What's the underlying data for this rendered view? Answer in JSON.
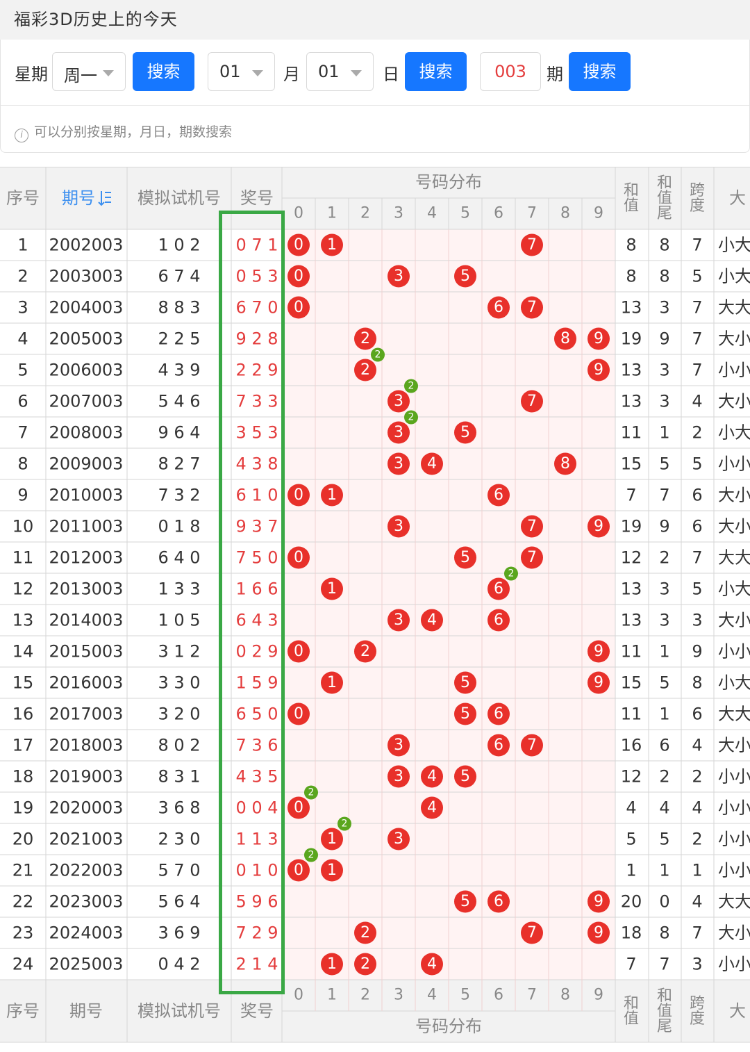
{
  "page_title": "福彩3D历史上的今天",
  "search": {
    "weekday_label": "星期",
    "weekday_value": "周一",
    "search_button": "搜索",
    "month_value": "01",
    "month_label": "月",
    "day_value": "01",
    "day_label": "日",
    "period_value": "003",
    "period_label": "期",
    "hint": "可以分别按星期，月日，期数搜索"
  },
  "table": {
    "headers": {
      "seq": "序号",
      "period": "期号",
      "sim": "模拟试机号",
      "prize": "奖号",
      "dist": "号码分布",
      "sum": "和值",
      "sum_tail": "和值尾",
      "span": "跨度",
      "big": "大"
    },
    "digits": [
      "0",
      "1",
      "2",
      "3",
      "4",
      "5",
      "6",
      "7",
      "8",
      "9"
    ],
    "rows": [
      {
        "seq": "1",
        "period": "2002003",
        "sim": "1 0 2",
        "prize": "0 7 1",
        "sum": "8",
        "tail": "8",
        "span": "7",
        "bs": "小大"
      },
      {
        "seq": "2",
        "period": "2003003",
        "sim": "6 7 4",
        "prize": "0 5 3",
        "sum": "8",
        "tail": "8",
        "span": "5",
        "bs": "小大"
      },
      {
        "seq": "3",
        "period": "2004003",
        "sim": "8 8 3",
        "prize": "6 7 0",
        "sum": "13",
        "tail": "3",
        "span": "7",
        "bs": "大大"
      },
      {
        "seq": "4",
        "period": "2005003",
        "sim": "2 2 5",
        "prize": "9 2 8",
        "sum": "19",
        "tail": "9",
        "span": "7",
        "bs": "大小"
      },
      {
        "seq": "5",
        "period": "2006003",
        "sim": "4 3 9",
        "prize": "2 2 9",
        "sum": "13",
        "tail": "3",
        "span": "7",
        "bs": "小小"
      },
      {
        "seq": "6",
        "period": "2007003",
        "sim": "5 4 6",
        "prize": "7 3 3",
        "sum": "13",
        "tail": "3",
        "span": "4",
        "bs": "大小"
      },
      {
        "seq": "7",
        "period": "2008003",
        "sim": "9 6 4",
        "prize": "3 5 3",
        "sum": "11",
        "tail": "1",
        "span": "2",
        "bs": "小大"
      },
      {
        "seq": "8",
        "period": "2009003",
        "sim": "8 2 7",
        "prize": "4 3 8",
        "sum": "15",
        "tail": "5",
        "span": "5",
        "bs": "小小"
      },
      {
        "seq": "9",
        "period": "2010003",
        "sim": "7 3 2",
        "prize": "6 1 0",
        "sum": "7",
        "tail": "7",
        "span": "6",
        "bs": "大小"
      },
      {
        "seq": "10",
        "period": "2011003",
        "sim": "0 1 8",
        "prize": "9 3 7",
        "sum": "19",
        "tail": "9",
        "span": "6",
        "bs": "大小"
      },
      {
        "seq": "11",
        "period": "2012003",
        "sim": "6 4 0",
        "prize": "7 5 0",
        "sum": "12",
        "tail": "2",
        "span": "7",
        "bs": "大大"
      },
      {
        "seq": "12",
        "period": "2013003",
        "sim": "1 3 3",
        "prize": "1 6 6",
        "sum": "13",
        "tail": "3",
        "span": "5",
        "bs": "小大"
      },
      {
        "seq": "13",
        "period": "2014003",
        "sim": "1 0 5",
        "prize": "6 4 3",
        "sum": "13",
        "tail": "3",
        "span": "3",
        "bs": "大小"
      },
      {
        "seq": "14",
        "period": "2015003",
        "sim": "3 1 2",
        "prize": "0 2 9",
        "sum": "11",
        "tail": "1",
        "span": "9",
        "bs": "小小"
      },
      {
        "seq": "15",
        "period": "2016003",
        "sim": "3 3 0",
        "prize": "1 5 9",
        "sum": "15",
        "tail": "5",
        "span": "8",
        "bs": "小大"
      },
      {
        "seq": "16",
        "period": "2017003",
        "sim": "3 2 0",
        "prize": "6 5 0",
        "sum": "11",
        "tail": "1",
        "span": "6",
        "bs": "大大"
      },
      {
        "seq": "17",
        "period": "2018003",
        "sim": "8 0 2",
        "prize": "7 3 6",
        "sum": "16",
        "tail": "6",
        "span": "4",
        "bs": "大小"
      },
      {
        "seq": "18",
        "period": "2019003",
        "sim": "8 3 1",
        "prize": "4 3 5",
        "sum": "12",
        "tail": "2",
        "span": "2",
        "bs": "小小"
      },
      {
        "seq": "19",
        "period": "2020003",
        "sim": "3 6 8",
        "prize": "0 0 4",
        "sum": "4",
        "tail": "4",
        "span": "4",
        "bs": "小小"
      },
      {
        "seq": "20",
        "period": "2021003",
        "sim": "2 3 0",
        "prize": "1 1 3",
        "sum": "5",
        "tail": "5",
        "span": "2",
        "bs": "小小"
      },
      {
        "seq": "21",
        "period": "2022003",
        "sim": "5 7 0",
        "prize": "0 1 0",
        "sum": "1",
        "tail": "1",
        "span": "1",
        "bs": "小小"
      },
      {
        "seq": "22",
        "period": "2023003",
        "sim": "5 6 4",
        "prize": "5 9 6",
        "sum": "20",
        "tail": "0",
        "span": "4",
        "bs": "大大"
      },
      {
        "seq": "23",
        "period": "2024003",
        "sim": "3 6 9",
        "prize": "7 2 9",
        "sum": "18",
        "tail": "8",
        "span": "7",
        "bs": "大小"
      },
      {
        "seq": "24",
        "period": "2025003",
        "sim": "0 4 2",
        "prize": "2 1 4",
        "sum": "7",
        "tail": "7",
        "span": "3",
        "bs": "小小"
      }
    ]
  },
  "colors": {
    "ball_red": "#e8302a",
    "repeat_green": "#5aa61e",
    "highlight_green": "#3aa845",
    "header_bg": "#f2f2f2",
    "dist_bg": "#fff3f3",
    "prize_text": "#e43d3d",
    "link_blue": "#3b8ff0"
  },
  "icons": {
    "sort": "sort-icon",
    "info": "info-icon",
    "caret": "chevron-down-icon"
  }
}
